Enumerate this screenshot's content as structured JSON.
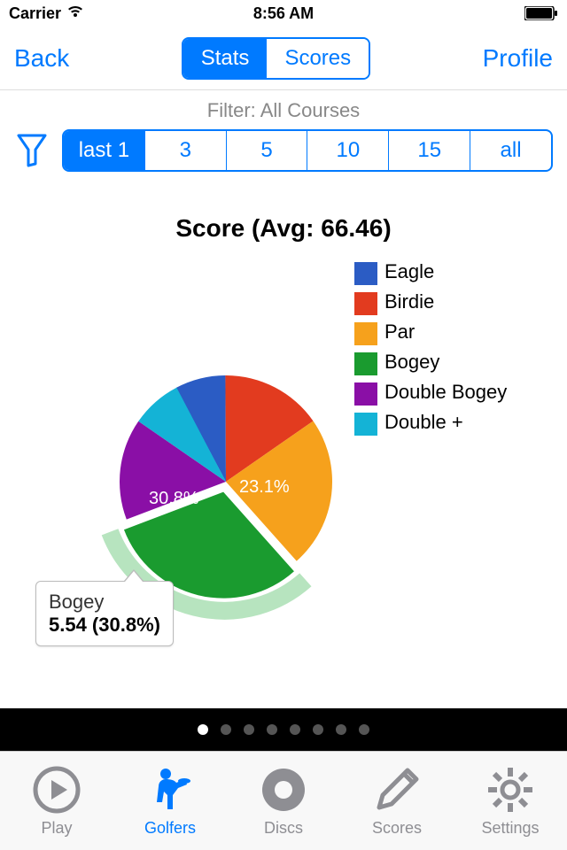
{
  "status": {
    "carrier": "Carrier",
    "time": "8:56 AM"
  },
  "nav": {
    "back": "Back",
    "profile": "Profile",
    "seg1": "Stats",
    "seg2": "Scores"
  },
  "filter": {
    "label": "Filter: All Courses",
    "opts": [
      "last 1",
      "3",
      "5",
      "10",
      "15",
      "all"
    ]
  },
  "chart": {
    "title": "Score (Avg: 66.46)",
    "label_par": "23.1%",
    "label_bogey": "30.8%",
    "legend": [
      "Eagle",
      "Birdie",
      "Par",
      "Bogey",
      "Double Bogey",
      "Double +"
    ],
    "callout_title": "Bogey",
    "callout_val": "5.54 (30.8%)"
  },
  "colors": {
    "eagle": "#2b5cc4",
    "birdie": "#e23b1f",
    "par": "#f6a11c",
    "bogey": "#1a9b2f",
    "dblbogey": "#8a0fa6",
    "dblplus": "#14b3d6"
  },
  "chart_data": {
    "type": "pie",
    "title": "Score (Avg: 66.46)",
    "series": [
      {
        "name": "Eagle",
        "percent": 7.7,
        "color": "#2b5cc4"
      },
      {
        "name": "Birdie",
        "percent": 15.4,
        "color": "#e23b1f"
      },
      {
        "name": "Par",
        "percent": 23.1,
        "color": "#f6a11c"
      },
      {
        "name": "Bogey",
        "percent": 30.8,
        "value": 5.54,
        "color": "#1a9b2f",
        "exploded": true
      },
      {
        "name": "Double Bogey",
        "percent": 15.4,
        "color": "#8a0fa6"
      },
      {
        "name": "Double +",
        "percent": 7.7,
        "color": "#14b3d6"
      }
    ]
  },
  "pagination": {
    "count": 8,
    "active": 0
  },
  "tabs": {
    "items": [
      "Play",
      "Golfers",
      "Discs",
      "Scores",
      "Settings"
    ],
    "active": 1
  }
}
